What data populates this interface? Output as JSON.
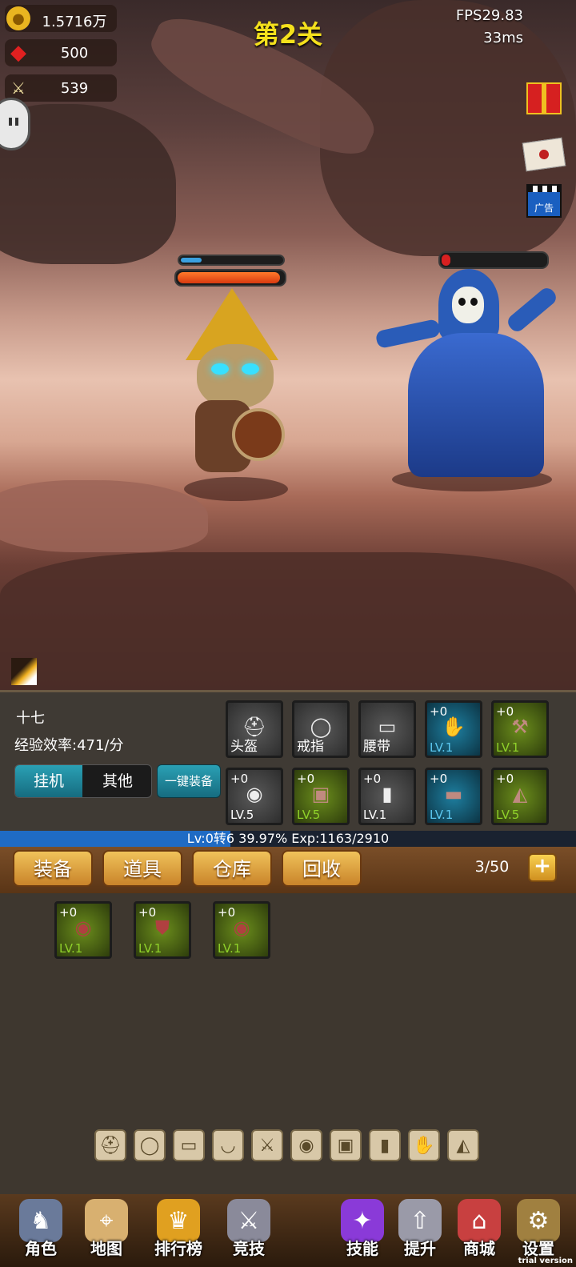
{
  "resources": {
    "gold": "1.5716万",
    "gems": "500",
    "power": "539"
  },
  "level_title": "第2关",
  "fps": "FPS29.83",
  "ms": "33ms",
  "side_buttons": [
    {
      "icon": "gift-icon"
    },
    {
      "icon": "mail-icon"
    },
    {
      "icon": "ad-icon",
      "label": "广告"
    }
  ],
  "player_hp_fraction": 0.97,
  "player_mp_fraction": 0.2,
  "enemy_hp_fraction": 0.05,
  "hero": {
    "name": "十七",
    "exp_rate": "经验效率:471/分"
  },
  "mode_tabs": [
    {
      "label": "挂机",
      "active": true
    },
    {
      "label": "其他",
      "active": false
    }
  ],
  "one_key_equip": "一键装备",
  "equip_slots": [
    {
      "name": "头盔",
      "type": "gray",
      "icon": "helmet-icon"
    },
    {
      "name": "戒指",
      "type": "gray",
      "icon": "ring-icon"
    },
    {
      "name": "腰带",
      "type": "gray",
      "icon": "belt-icon"
    },
    {
      "plus": "+0",
      "lv": "LV.1",
      "type": "blue",
      "icon": "glove-icon"
    },
    {
      "plus": "+0",
      "lv": "LV.1",
      "type": "green",
      "icon": "axe-icon"
    },
    {
      "plus": "+0",
      "lv": "LV.5",
      "type": "gray",
      "icon": "shield-icon"
    },
    {
      "plus": "+0",
      "lv": "LV.5",
      "type": "green",
      "icon": "armor-icon"
    },
    {
      "plus": "+0",
      "lv": "LV.1",
      "type": "gray",
      "icon": "boots-icon"
    },
    {
      "plus": "+0",
      "lv": "LV.1",
      "type": "blue",
      "icon": "bracer-icon"
    },
    {
      "plus": "+0",
      "lv": "LV.5",
      "type": "green",
      "icon": "cape-icon"
    }
  ],
  "exp_bar": {
    "text": "Lv:0转6 39.97%   Exp:1163/2910",
    "fraction": 0.3997
  },
  "bag_tabs": [
    "装备",
    "道具",
    "仓库",
    "回收"
  ],
  "bag_count": "3/50",
  "bag_items": [
    {
      "plus": "+0",
      "lv": "LV.1",
      "icon": "round-shield-icon"
    },
    {
      "plus": "+0",
      "lv": "LV.1",
      "icon": "kite-shield-icon"
    },
    {
      "plus": "+0",
      "lv": "LV.1",
      "icon": "round-shield-icon"
    }
  ],
  "filter_icons": [
    "helmet-icon",
    "ring-icon",
    "belt-icon",
    "necklace-icon",
    "weapon-icon",
    "shield-icon",
    "armor-icon",
    "boots-icon",
    "glove-icon",
    "cape-icon"
  ],
  "nav": [
    {
      "label": "角色",
      "icon": "character-icon"
    },
    {
      "label": "地图",
      "icon": "map-icon"
    },
    {
      "label": "排行榜",
      "icon": "trophy-icon"
    },
    {
      "label": "竞技",
      "icon": "swords-icon"
    },
    {
      "label": "技能",
      "icon": "skill-book-icon"
    },
    {
      "label": "提升",
      "icon": "upgrade-icon"
    },
    {
      "label": "商城",
      "icon": "shop-icon"
    },
    {
      "label": "设置",
      "icon": "gear-icon"
    }
  ],
  "watermark": "trial version",
  "colors": {
    "level_title": "#f4e01c",
    "lv_blue": "#5bc8f0",
    "lv_green": "#8fd12a",
    "tab_teal": "#1f8fa0"
  }
}
